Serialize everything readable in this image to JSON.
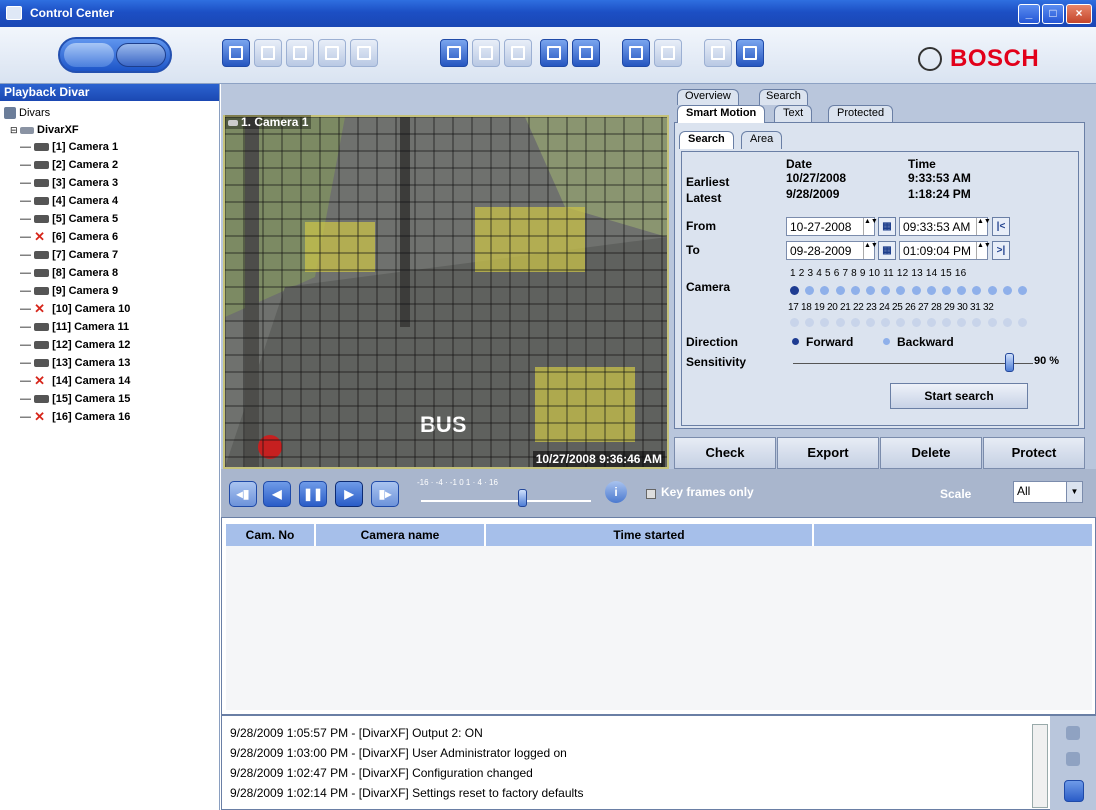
{
  "window": {
    "title": "Control Center"
  },
  "brand": {
    "name": "BOSCH",
    "color": "#e2001a"
  },
  "sidebar": {
    "title": "Playback Divar",
    "root": "Divars",
    "device": "DivarXF",
    "cameras": [
      {
        "label": "[1] Camera 1",
        "offline": false
      },
      {
        "label": "[2] Camera 2",
        "offline": false
      },
      {
        "label": "[3] Camera 3",
        "offline": false
      },
      {
        "label": "[4] Camera 4",
        "offline": false
      },
      {
        "label": "[5] Camera 5",
        "offline": false
      },
      {
        "label": "[6] Camera 6",
        "offline": true
      },
      {
        "label": "[7] Camera 7",
        "offline": false
      },
      {
        "label": "[8] Camera 8",
        "offline": false
      },
      {
        "label": "[9] Camera 9",
        "offline": false
      },
      {
        "label": "[10] Camera 10",
        "offline": true
      },
      {
        "label": "[11] Camera 11",
        "offline": false
      },
      {
        "label": "[12] Camera 12",
        "offline": false
      },
      {
        "label": "[13] Camera 13",
        "offline": false
      },
      {
        "label": "[14] Camera 14",
        "offline": true
      },
      {
        "label": "[15] Camera 15",
        "offline": false
      },
      {
        "label": "[16] Camera 16",
        "offline": true
      }
    ]
  },
  "video": {
    "label": "1. Camera 1",
    "timestamp": "10/27/2008 9:36:46 AM"
  },
  "search": {
    "top_tabs": [
      "Overview",
      "Search"
    ],
    "sub_tabs": [
      "Smart Motion",
      "Text",
      "Protected"
    ],
    "inner_tabs": [
      "Search",
      "Area"
    ],
    "col_date": "Date",
    "col_time": "Time",
    "earliest_label": "Earliest",
    "earliest_date": "10/27/2008",
    "earliest_time": "9:33:53 AM",
    "latest_label": "Latest",
    "latest_date": "9/28/2009",
    "latest_time": "1:18:24 PM",
    "from_label": "From",
    "from_date": "10-27-2008",
    "from_time": "09:33:53 AM",
    "to_label": "To",
    "to_date": "09-28-2009",
    "to_time": "01:09:04 PM",
    "camera_label": "Camera",
    "cam_row1": "1 2 3 4 5 6 7 8 9 10 11 12 13 14 15 16",
    "cam_row2": "17 18 19 20 21 22 23 24 25 26 27 28 29 30 31 32",
    "selected_camera": 1,
    "direction_label": "Direction",
    "dir_forward": "Forward",
    "dir_backward": "Backward",
    "direction_selected": "Forward",
    "sensitivity_label": "Sensitivity",
    "sensitivity_value": "90 %",
    "sensitivity_level": 0.9,
    "start_button": "Start search",
    "first_btn": "|<",
    "last_btn": ">|"
  },
  "actions": [
    "Check",
    "Export",
    "Delete",
    "Protect"
  ],
  "transport": {
    "speed_ticks": "-16  ·  -4  ·  -1  0  1  ·  4  ·  16",
    "speed_value": 1,
    "key_frames_label": "Key frames only",
    "scale_label": "Scale",
    "scale_value": "All"
  },
  "results": {
    "headers": [
      "Cam. No",
      "Camera name",
      "Time started",
      ""
    ]
  },
  "log": [
    "9/28/2009 1:05:57 PM - [DivarXF] Output 2: ON",
    "9/28/2009 1:03:00 PM - [DivarXF] User Administrator logged on",
    "9/28/2009 1:02:47 PM - [DivarXF] Configuration changed",
    "9/28/2009 1:02:14 PM - [DivarXF] Settings reset to factory defaults"
  ]
}
